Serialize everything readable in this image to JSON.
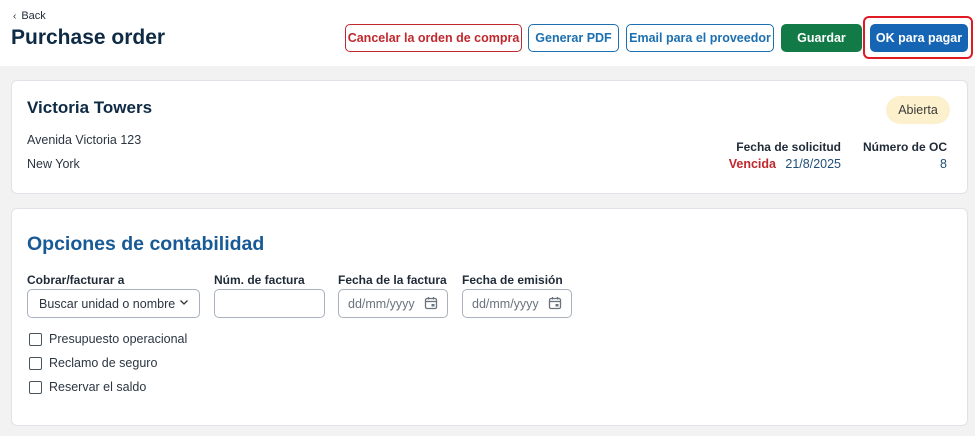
{
  "header": {
    "back_label": "Back",
    "title": "Purchase order",
    "buttons": {
      "cancel": "Cancelar la orden de compra",
      "pdf": "Generar PDF",
      "email": "Email para el proveedor",
      "save": "Guardar",
      "ok": "OK para pagar"
    }
  },
  "property": {
    "name": "Victoria Towers",
    "address_line1": "Avenida Victoria 123",
    "address_line2": "New York",
    "status": "Abierta",
    "request_date_label": "Fecha de solicitud",
    "overdue_label": "Vencida",
    "request_date": "21/8/2025",
    "po_number_label": "Número de OC",
    "po_number": "8"
  },
  "accounting": {
    "title": "Opciones de contabilidad",
    "bill_to_label": "Cobrar/facturar a",
    "bill_to_placeholder": "Buscar unidad o nombre",
    "invoice_number_label": "Núm. de factura",
    "invoice_number_value": "",
    "invoice_date_label": "Fecha de la factura",
    "invoice_date_placeholder": "dd/mm/yyyy",
    "issue_date_label": "Fecha de emisión",
    "issue_date_placeholder": "dd/mm/yyyy",
    "checkboxes": [
      {
        "label": "Presupuesto operacional",
        "checked": false
      },
      {
        "label": "Reclamo de seguro",
        "checked": false
      },
      {
        "label": "Reservar el saldo",
        "checked": false
      }
    ]
  },
  "colors": {
    "cancel": "#c0282d",
    "outline_blue": "#1c6fb0",
    "save_green": "#117a46",
    "ok_blue": "#1565b4",
    "status_badge": "#fdf0cd",
    "highlight": "#e01b24"
  }
}
